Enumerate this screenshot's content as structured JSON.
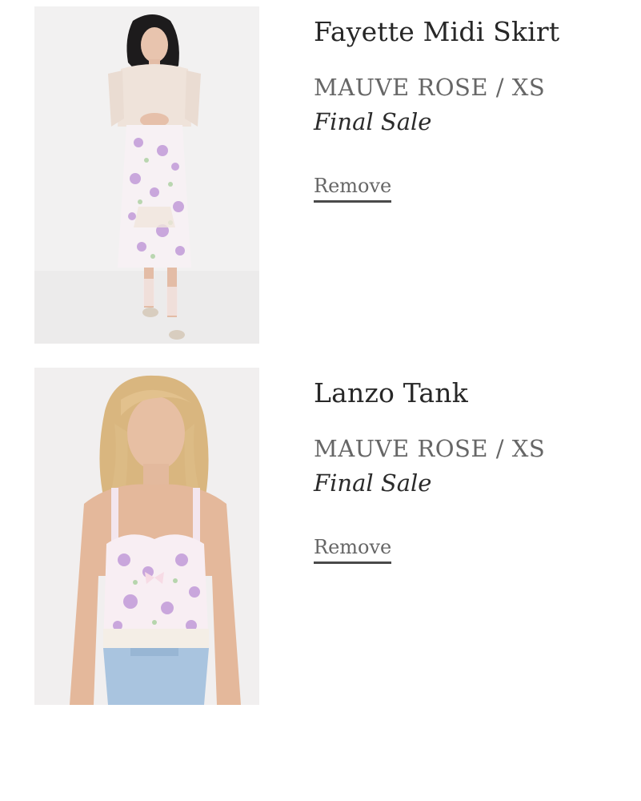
{
  "cart": {
    "items": [
      {
        "title": "Fayette Midi Skirt",
        "variant": "MAUVE ROSE / XS",
        "note": "Final Sale",
        "remove_label": "Remove"
      },
      {
        "title": "Lanzo Tank",
        "variant": "MAUVE ROSE / XS",
        "note": "Final Sale",
        "remove_label": "Remove"
      }
    ]
  },
  "colors": {
    "title_text": "#272727",
    "variant_text": "#666666",
    "underline": "#4a4a4a",
    "background": "#ffffff"
  }
}
